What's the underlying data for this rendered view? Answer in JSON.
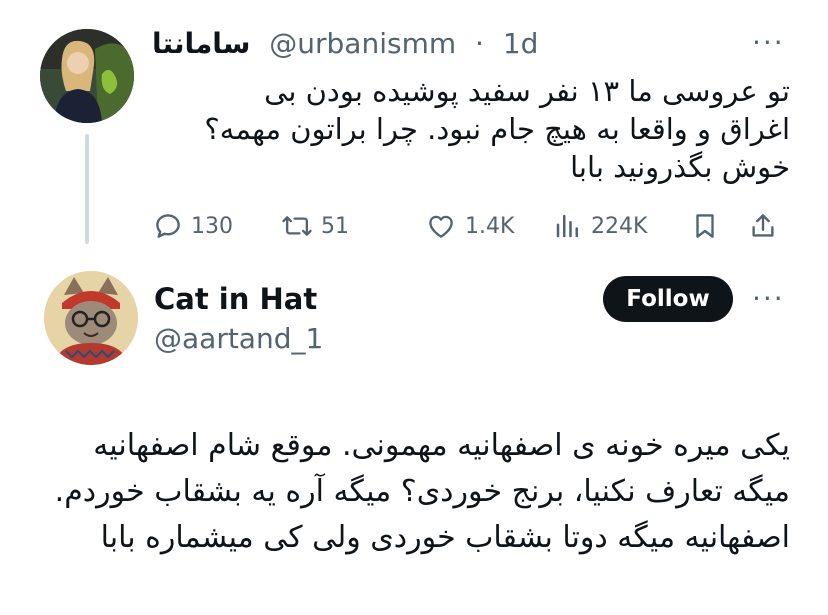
{
  "tweet1": {
    "display_name": "سامانتا",
    "handle": "@urbanismm",
    "separator": "·",
    "time": "1d",
    "text": "تو عروسی ما ۱۳ نفر سفید پوشیده بودن بی اغراق و واقعا به هیچ جام نبود. چرا براتون مهمه؟خوش بگذرونید بابا",
    "replies": "130",
    "retweets": "51",
    "likes": "1.4K",
    "views": "224K",
    "more_icon": "ellipsis-icon"
  },
  "tweet2": {
    "display_name": "Cat in Hat",
    "handle": "@aartand_1",
    "follow_label": "Follow",
    "text": "یکی میره خونه ی اصفهانیه مهمونی. موقع شام اصفهانیه میگه تعارف نکنیا، برنج خوردی؟ میگه آره یه بشقاب خوردم. اصفهانیه میگه دوتا بشقاب خوردی ولی کی میشماره بابا"
  },
  "colors": {
    "text": "#0f1419",
    "secondary": "#536471",
    "thread_line": "#cfd9de",
    "follow_bg": "#0f1419"
  }
}
